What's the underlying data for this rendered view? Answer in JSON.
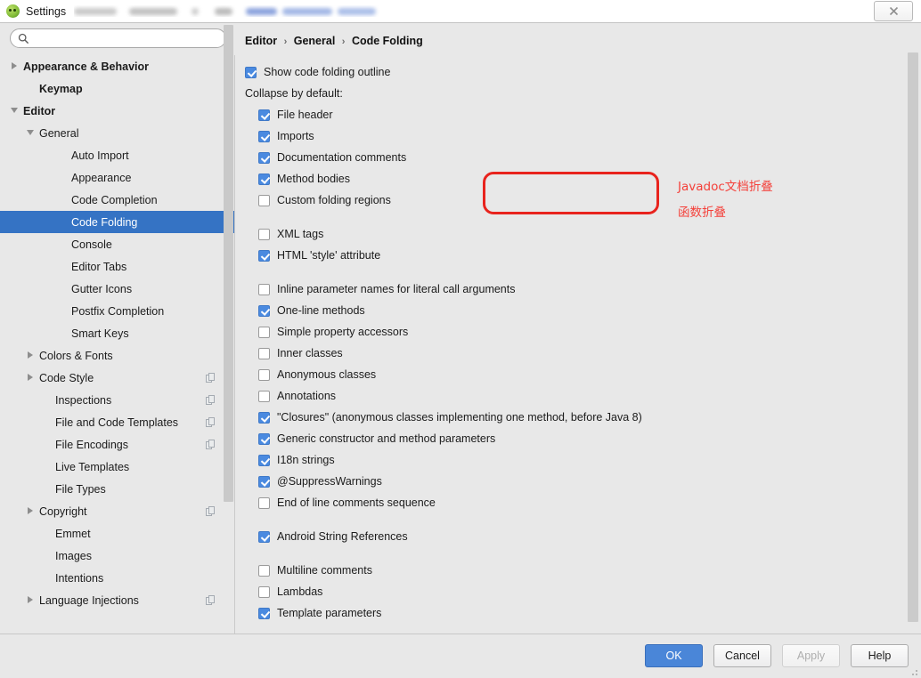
{
  "titlebar": {
    "app_icon": "idea-app-icon",
    "title": "Settings",
    "close_label": "close-icon"
  },
  "sidebar": {
    "search": {
      "value": "",
      "placeholder": "",
      "icon": "search-icon"
    },
    "items": [
      {
        "label": "Appearance & Behavior",
        "indent": 0,
        "twisty": "collapsed",
        "bold": true,
        "selected": false,
        "scope_icon": false
      },
      {
        "label": "Keymap",
        "indent": 1,
        "twisty": "none",
        "bold": true,
        "selected": false,
        "scope_icon": false
      },
      {
        "label": "Editor",
        "indent": 0,
        "twisty": "expanded",
        "bold": true,
        "selected": false,
        "scope_icon": false
      },
      {
        "label": "General",
        "indent": 1,
        "twisty": "expanded",
        "bold": false,
        "selected": false,
        "scope_icon": false
      },
      {
        "label": "Auto Import",
        "indent": 3,
        "twisty": "none",
        "bold": false,
        "selected": false,
        "scope_icon": false
      },
      {
        "label": "Appearance",
        "indent": 3,
        "twisty": "none",
        "bold": false,
        "selected": false,
        "scope_icon": false
      },
      {
        "label": "Code Completion",
        "indent": 3,
        "twisty": "none",
        "bold": false,
        "selected": false,
        "scope_icon": false
      },
      {
        "label": "Code Folding",
        "indent": 3,
        "twisty": "none",
        "bold": false,
        "selected": true,
        "scope_icon": false
      },
      {
        "label": "Console",
        "indent": 3,
        "twisty": "none",
        "bold": false,
        "selected": false,
        "scope_icon": false
      },
      {
        "label": "Editor Tabs",
        "indent": 3,
        "twisty": "none",
        "bold": false,
        "selected": false,
        "scope_icon": false
      },
      {
        "label": "Gutter Icons",
        "indent": 3,
        "twisty": "none",
        "bold": false,
        "selected": false,
        "scope_icon": false
      },
      {
        "label": "Postfix Completion",
        "indent": 3,
        "twisty": "none",
        "bold": false,
        "selected": false,
        "scope_icon": false
      },
      {
        "label": "Smart Keys",
        "indent": 3,
        "twisty": "none",
        "bold": false,
        "selected": false,
        "scope_icon": false
      },
      {
        "label": "Colors & Fonts",
        "indent": 1,
        "twisty": "collapsed",
        "bold": false,
        "selected": false,
        "scope_icon": false
      },
      {
        "label": "Code Style",
        "indent": 1,
        "twisty": "collapsed",
        "bold": false,
        "selected": false,
        "scope_icon": true
      },
      {
        "label": "Inspections",
        "indent": 2,
        "twisty": "none",
        "bold": false,
        "selected": false,
        "scope_icon": true
      },
      {
        "label": "File and Code Templates",
        "indent": 2,
        "twisty": "none",
        "bold": false,
        "selected": false,
        "scope_icon": true
      },
      {
        "label": "File Encodings",
        "indent": 2,
        "twisty": "none",
        "bold": false,
        "selected": false,
        "scope_icon": true
      },
      {
        "label": "Live Templates",
        "indent": 2,
        "twisty": "none",
        "bold": false,
        "selected": false,
        "scope_icon": false
      },
      {
        "label": "File Types",
        "indent": 2,
        "twisty": "none",
        "bold": false,
        "selected": false,
        "scope_icon": false
      },
      {
        "label": "Copyright",
        "indent": 1,
        "twisty": "collapsed",
        "bold": false,
        "selected": false,
        "scope_icon": true
      },
      {
        "label": "Emmet",
        "indent": 2,
        "twisty": "none",
        "bold": false,
        "selected": false,
        "scope_icon": false
      },
      {
        "label": "Images",
        "indent": 2,
        "twisty": "none",
        "bold": false,
        "selected": false,
        "scope_icon": false
      },
      {
        "label": "Intentions",
        "indent": 2,
        "twisty": "none",
        "bold": false,
        "selected": false,
        "scope_icon": false
      },
      {
        "label": "Language Injections",
        "indent": 1,
        "twisty": "collapsed",
        "bold": false,
        "selected": false,
        "scope_icon": true
      }
    ]
  },
  "content": {
    "breadcrumb": {
      "part1": "Editor",
      "part2": "General",
      "part3": "Code Folding",
      "separator": "›"
    },
    "show_outline": {
      "label": "Show code folding outline",
      "checked": true
    },
    "collapse_header": "Collapse by default:",
    "groups": [
      {
        "indent": 1,
        "items": [
          {
            "label": "File header",
            "checked": true
          },
          {
            "label": "Imports",
            "checked": true
          },
          {
            "label": "Documentation comments",
            "checked": true
          },
          {
            "label": "Method bodies",
            "checked": true
          },
          {
            "label": "Custom folding regions",
            "checked": false
          }
        ]
      },
      {
        "indent": 1,
        "items": [
          {
            "label": "XML tags",
            "checked": false
          },
          {
            "label": "HTML 'style' attribute",
            "checked": true
          }
        ]
      },
      {
        "indent": 1,
        "items": [
          {
            "label": "Inline parameter names for literal call arguments",
            "checked": false
          },
          {
            "label": "One-line methods",
            "checked": true
          },
          {
            "label": "Simple property accessors",
            "checked": false
          },
          {
            "label": "Inner classes",
            "checked": false
          },
          {
            "label": "Anonymous classes",
            "checked": false
          },
          {
            "label": "Annotations",
            "checked": false
          },
          {
            "label": "\"Closures\" (anonymous classes implementing one method, before Java 8)",
            "checked": true
          },
          {
            "label": "Generic constructor and method parameters",
            "checked": true
          },
          {
            "label": "I18n strings",
            "checked": true
          },
          {
            "label": "@SuppressWarnings",
            "checked": true
          },
          {
            "label": "End of line comments sequence",
            "checked": false
          }
        ]
      },
      {
        "indent": 1,
        "items": [
          {
            "label": "Android String References",
            "checked": true
          }
        ]
      },
      {
        "indent": 1,
        "items": [
          {
            "label": "Multiline comments",
            "checked": false
          },
          {
            "label": "Lambdas",
            "checked": false
          },
          {
            "label": "Template parameters",
            "checked": true
          }
        ]
      }
    ]
  },
  "annotations": {
    "highlight_color": "#e8231d",
    "text_color": "#f4403a",
    "note1": "Javadoc文档折叠",
    "note2": "函数折叠"
  },
  "footer": {
    "ok": "OK",
    "cancel": "Cancel",
    "apply": "Apply",
    "help": "Help"
  }
}
